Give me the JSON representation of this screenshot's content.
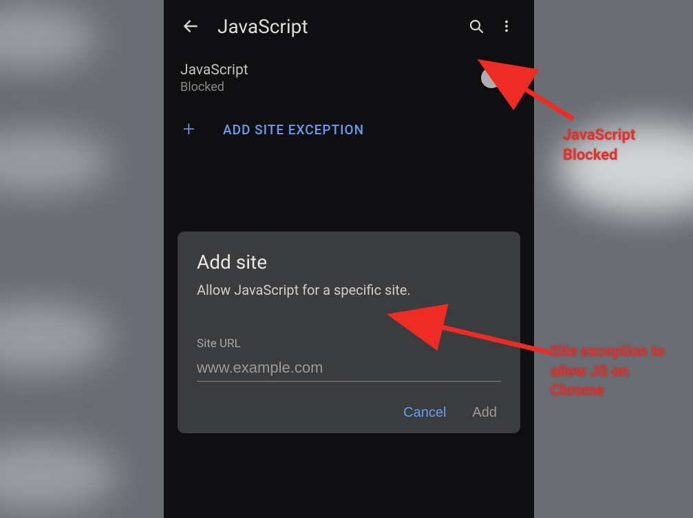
{
  "header": {
    "title": "JavaScript"
  },
  "setting": {
    "title": "JavaScript",
    "status": "Blocked",
    "enabled": false
  },
  "exception": {
    "button": "ADD SITE EXCEPTION"
  },
  "dialog": {
    "title": "Add site",
    "description": "Allow JavaScript for a specific site.",
    "field_label": "Site URL",
    "placeholder": "www.example.com",
    "value": "",
    "cancel": "Cancel",
    "add": "Add"
  },
  "annotations": {
    "a1": "JavaScript\nBlocked",
    "a2": "Site exception to\nallow JS on\nChrome"
  }
}
